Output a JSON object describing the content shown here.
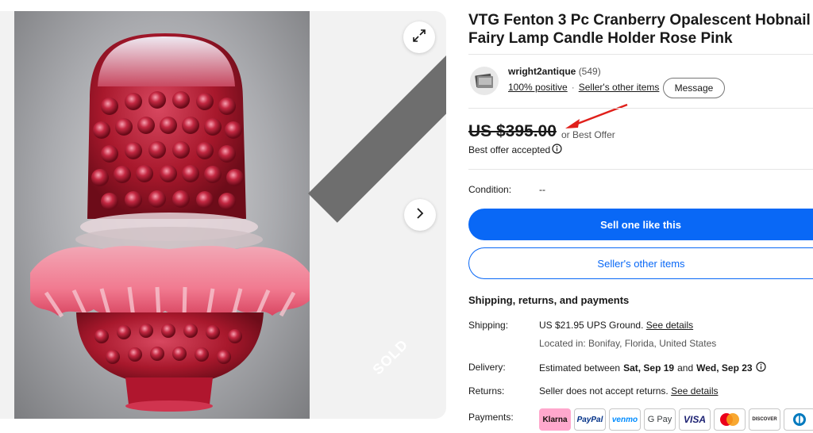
{
  "listing": {
    "title": "VTG Fenton 3 Pc Cranberry Opalescent Hobnail Fairy Lamp Candle Holder Rose Pink",
    "sold_overlay": "SOLD"
  },
  "seller": {
    "name": "wright2antique",
    "feedback_count": "(549)",
    "positive": "100% positive",
    "other_items_link": "Seller's other items",
    "message_button": "Message"
  },
  "price": {
    "amount": "US $395.00",
    "best_offer": "or Best Offer",
    "offer_accepted": "Best offer accepted"
  },
  "condition": {
    "label": "Condition:",
    "value": "--"
  },
  "actions": {
    "sell_one": "Sell one like this",
    "sellers_items": "Seller's other items"
  },
  "shipping": {
    "section_title": "Shipping, returns, and payments",
    "shipping_label": "Shipping:",
    "shipping_value": "US $21.95 UPS Ground.",
    "shipping_link": "See details",
    "location": "Located in: Bonifay, Florida, United States",
    "delivery_label": "Delivery:",
    "delivery_prefix": "Estimated between",
    "delivery_start": "Sat, Sep 19",
    "delivery_and": "and",
    "delivery_end": "Wed, Sep 23",
    "returns_label": "Returns:",
    "returns_value": "Seller does not accept returns.",
    "returns_link": "See details",
    "payments_label": "Payments:"
  },
  "payments": [
    "Klarna",
    "PayPal",
    "venmo",
    "G Pay",
    "VISA",
    "Mastercard",
    "DISCOVER",
    "Diners"
  ],
  "colors": {
    "primary_blue": "#0968f6",
    "text": "#191919",
    "annotation_arrow": "#e0201b"
  },
  "icons": {
    "expand": "expand-icon",
    "next": "chevron-right-icon",
    "info": "info-icon"
  }
}
